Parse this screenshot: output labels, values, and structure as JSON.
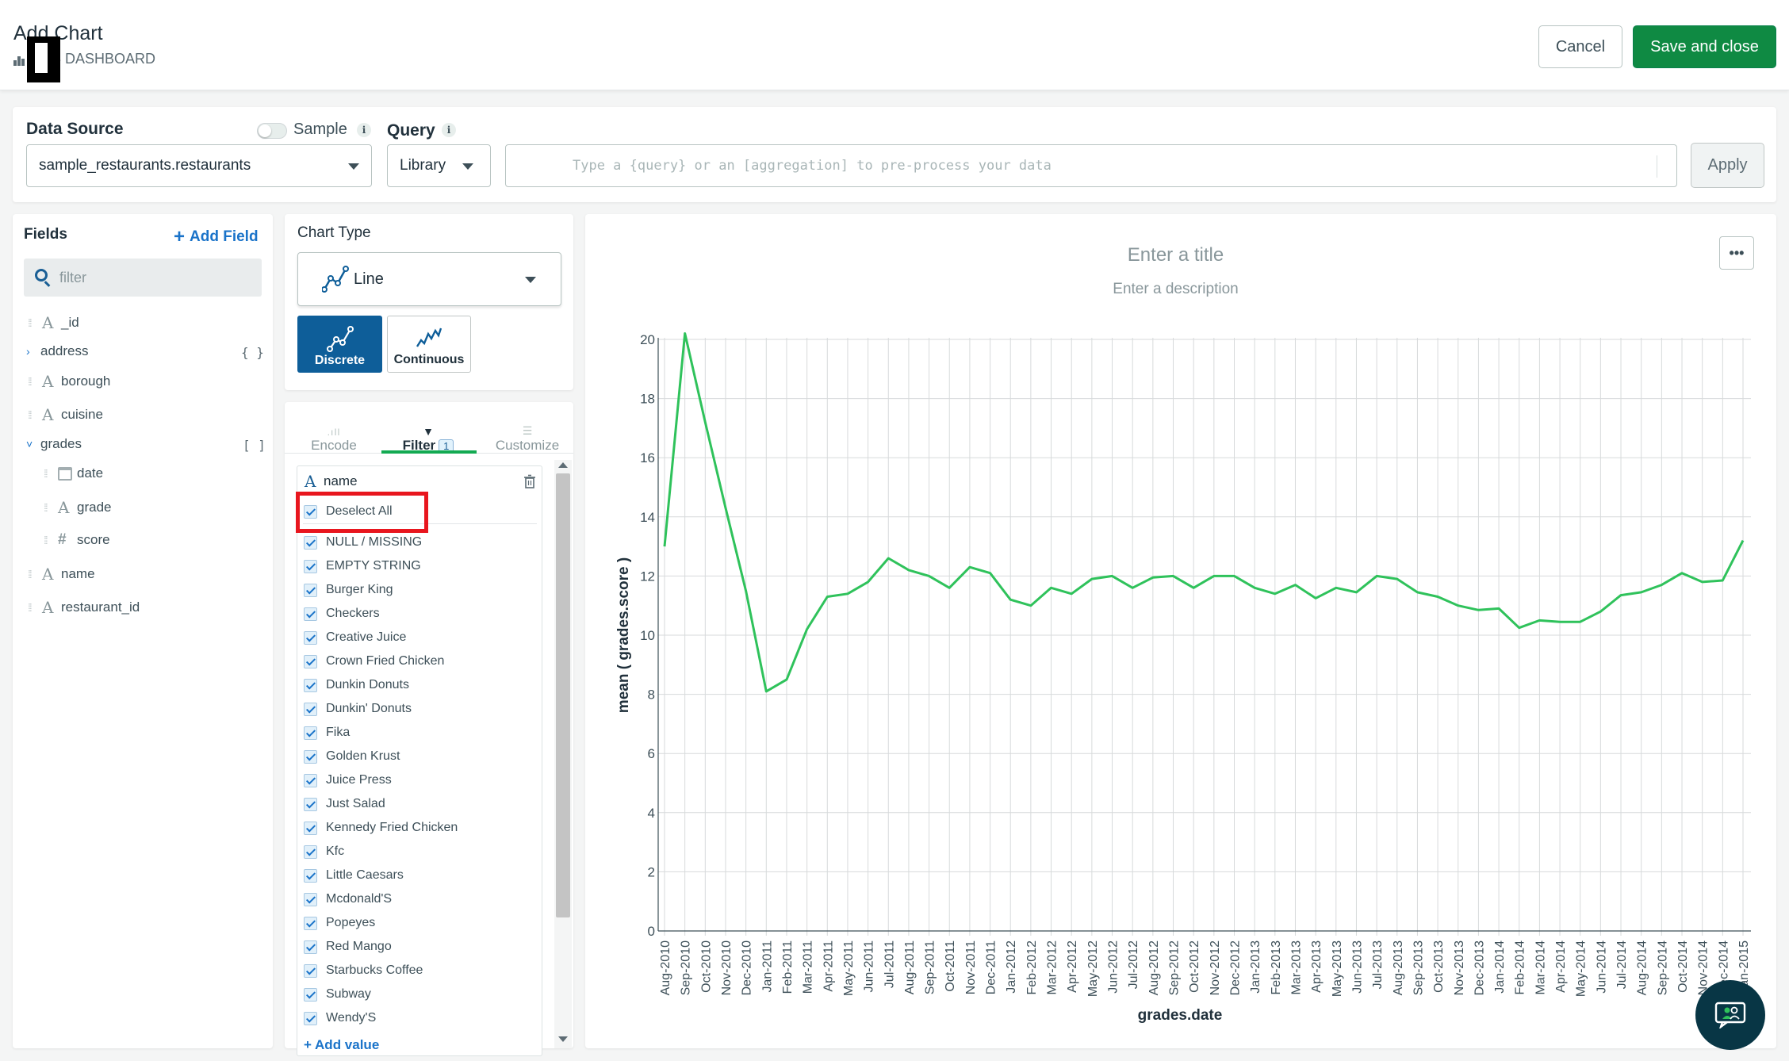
{
  "header": {
    "title": "Add Chart",
    "dashboard_label": "S DASHBOARD",
    "cancel_label": "Cancel",
    "save_label": "Save and close"
  },
  "data_source": {
    "label": "Data Source",
    "sample_label": "Sample",
    "selected": "sample_restaurants.restaurants",
    "query_label": "Query",
    "query_mode": "Library",
    "query_placeholder": "Type a {query} or an [aggregation] to pre-process your data",
    "apply_label": "Apply"
  },
  "fields": {
    "title": "Fields",
    "add_field_label": "Add Field",
    "search_placeholder": "filter",
    "items": [
      {
        "name": "_id",
        "type": "string"
      },
      {
        "name": "address",
        "type": "object",
        "badge": "{ }"
      },
      {
        "name": "borough",
        "type": "string"
      },
      {
        "name": "cuisine",
        "type": "string"
      },
      {
        "name": "grades",
        "type": "array",
        "badge": "[ ]"
      },
      {
        "name": "date",
        "type": "date"
      },
      {
        "name": "grade",
        "type": "string"
      },
      {
        "name": "score",
        "type": "number"
      },
      {
        "name": "name",
        "type": "string"
      },
      {
        "name": "restaurant_id",
        "type": "string"
      }
    ]
  },
  "chart_type": {
    "label": "Chart Type",
    "selected": "Line",
    "discrete_label": "Discrete",
    "continuous_label": "Continuous"
  },
  "tabs": {
    "encode": "Encode",
    "filter": "Filter",
    "filter_count": "1",
    "customize": "Customize"
  },
  "filter": {
    "field_name": "name",
    "deselect_all": "Deselect All",
    "values": [
      "NULL / MISSING",
      "EMPTY STRING",
      "Burger King",
      "Checkers",
      "Creative Juice",
      "Crown Fried Chicken",
      "Dunkin Donuts",
      "Dunkin' Donuts",
      "Fika",
      "Golden Krust",
      "Juice Press",
      "Just Salad",
      "Kennedy Fried Chicken",
      "Kfc",
      "Little Caesars",
      "Mcdonald'S",
      "Popeyes",
      "Red Mango",
      "Starbucks Coffee",
      "Subway",
      "Wendy'S"
    ],
    "add_value_label": "Add value"
  },
  "chart": {
    "title_placeholder": "Enter a title",
    "description_placeholder": "Enter a description",
    "more_label": "•••"
  },
  "colors": {
    "line": "#2fc25b",
    "accent_green": "#0f8a43",
    "accent_blue": "#0e5e99",
    "highlight_red": "#e8161e"
  },
  "chart_data": {
    "type": "line",
    "xlabel": "grades.date",
    "ylabel": "mean ( grades.score )",
    "ylim": [
      0,
      20
    ],
    "yticks": [
      0,
      2,
      4,
      6,
      8,
      10,
      12,
      14,
      16,
      18,
      20
    ],
    "grid": true,
    "categories": [
      "Aug-2010",
      "Sep-2010",
      "Oct-2010",
      "Nov-2010",
      "Dec-2010",
      "Jan-2011",
      "Feb-2011",
      "Mar-2011",
      "Apr-2011",
      "May-2011",
      "Jun-2011",
      "Jul-2011",
      "Aug-2011",
      "Sep-2011",
      "Oct-2011",
      "Nov-2011",
      "Dec-2011",
      "Jan-2012",
      "Feb-2012",
      "Mar-2012",
      "Apr-2012",
      "May-2012",
      "Jun-2012",
      "Jul-2012",
      "Aug-2012",
      "Sep-2012",
      "Oct-2012",
      "Nov-2012",
      "Dec-2012",
      "Jan-2013",
      "Feb-2013",
      "Mar-2013",
      "Apr-2013",
      "May-2013",
      "Jun-2013",
      "Jul-2013",
      "Aug-2013",
      "Sep-2013",
      "Oct-2013",
      "Nov-2013",
      "Dec-2013",
      "Jan-2014",
      "Feb-2014",
      "Mar-2014",
      "Apr-2014",
      "May-2014",
      "Jun-2014",
      "Jul-2014",
      "Aug-2014",
      "Sep-2014",
      "Oct-2014",
      "Nov-2014",
      "Dec-2014",
      "Jan-2015"
    ],
    "values": [
      13.0,
      20.2,
      17.2,
      14.3,
      11.5,
      8.1,
      8.5,
      10.2,
      11.3,
      11.4,
      11.8,
      12.6,
      12.2,
      12.0,
      11.6,
      12.3,
      12.1,
      11.2,
      11.0,
      11.6,
      11.4,
      11.9,
      12.0,
      11.6,
      11.95,
      12.0,
      11.6,
      12.0,
      12.0,
      11.6,
      11.4,
      11.7,
      11.25,
      11.6,
      11.45,
      12.0,
      11.9,
      11.45,
      11.3,
      11.0,
      10.85,
      10.9,
      10.25,
      10.5,
      10.45,
      10.45,
      10.8,
      11.35,
      11.45,
      11.7,
      12.1,
      11.8,
      11.85,
      13.2
    ]
  }
}
